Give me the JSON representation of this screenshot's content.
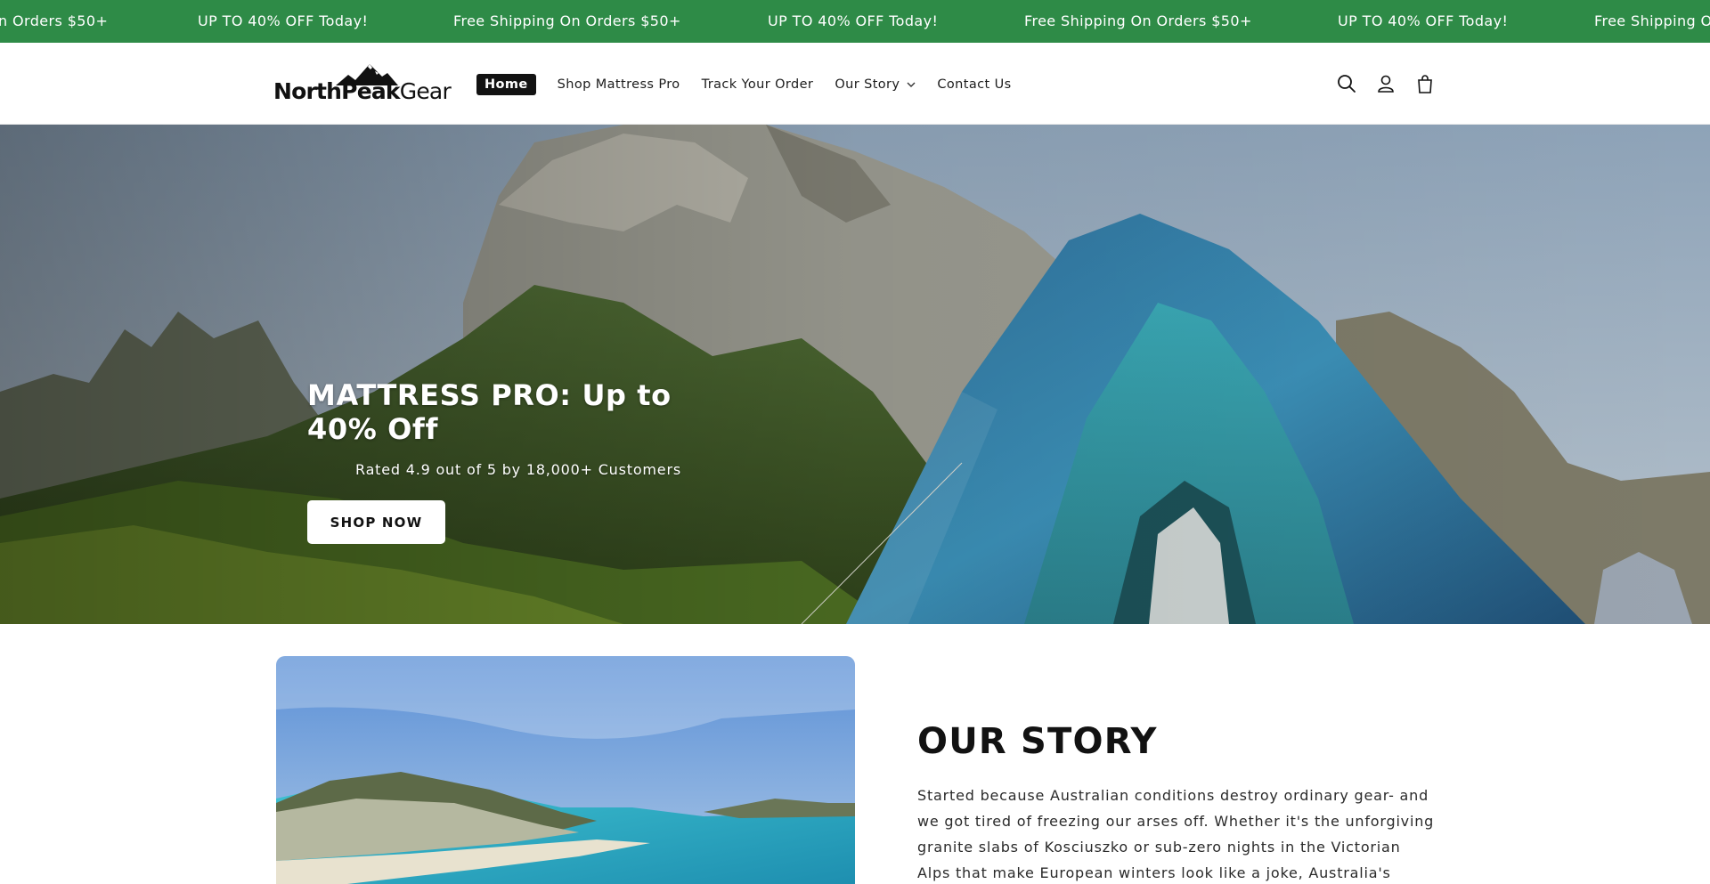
{
  "announcement": {
    "items": [
      "n Orders $50+",
      "UP TO 40% OFF Today!",
      "Free Shipping On Orders $50+",
      "UP TO 40% OFF Today!",
      "Free Shipping On Orders $50+",
      "UP TO 40% OFF Today!",
      "Free Shipping O"
    ],
    "background": "#2e8b47"
  },
  "header": {
    "logo": {
      "bold": "NorthPeak",
      "light": "Gear"
    },
    "nav": [
      {
        "label": "Home",
        "active": true
      },
      {
        "label": "Shop Mattress Pro"
      },
      {
        "label": "Track Your Order"
      },
      {
        "label": "Our Story",
        "dropdown": true
      },
      {
        "label": "Contact Us"
      }
    ],
    "icons": [
      "search-icon",
      "account-icon",
      "cart-icon"
    ]
  },
  "hero": {
    "title": "MATTRESS PRO: Up to 40% Off",
    "subtitle": "Rated 4.9 out of 5 by 18,000+ Customers",
    "button": "SHOP NOW"
  },
  "story": {
    "title": "OUR STORY",
    "body": "Started because Australian conditions destroy ordinary gear- and we got tired of freezing our arses off. Whether it's the unforgiving granite slabs of Kosciuszko or sub-zero nights in the Victorian Alps that make European winters look like a joke, Australia's wilderness has a"
  }
}
